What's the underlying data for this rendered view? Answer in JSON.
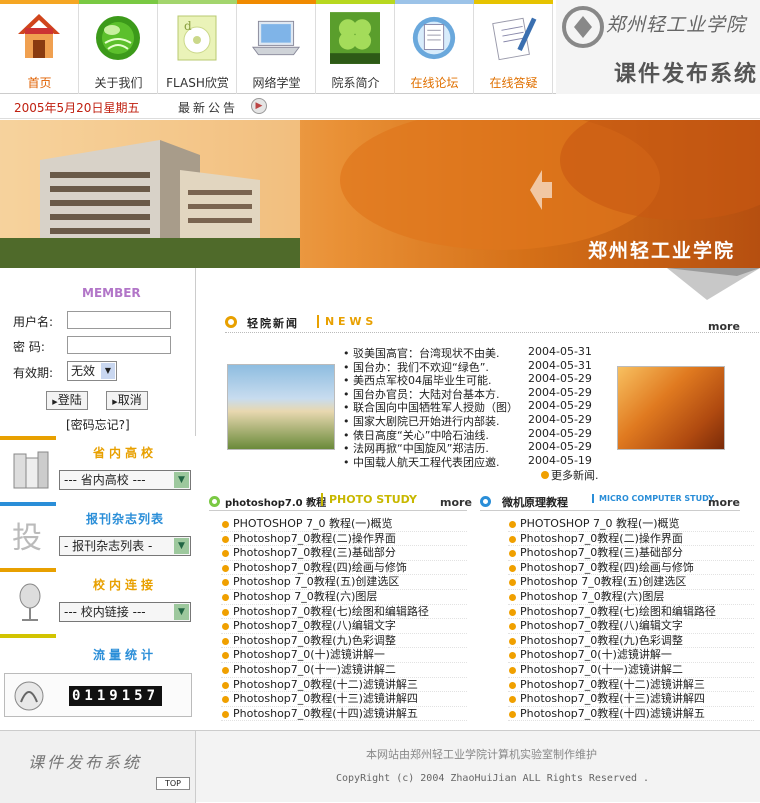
{
  "colors": {
    "accent_orange": "#f08a00",
    "date_red": "#c02010",
    "member_purple": "#b276c8",
    "news_orange": "#e8a000",
    "study_yellow": "#d2c400",
    "micro_blue": "#2a8ed8"
  },
  "nav": [
    {
      "label": "首页",
      "icon": "home-icon",
      "strip": "#f5a623",
      "color": "#e06000"
    },
    {
      "label": "关于我们",
      "icon": "globe-icon",
      "strip": "#7ac943",
      "color": "#333"
    },
    {
      "label": "FLASH欣赏",
      "icon": "flash-disc-icon",
      "strip": "#a3d56d",
      "color": "#333"
    },
    {
      "label": "网络学堂",
      "icon": "laptop-icon",
      "strip": "#f08a00",
      "color": "#333"
    },
    {
      "label": "院系简介",
      "icon": "clover-server-icon",
      "strip": "#b8d820",
      "color": "#333"
    },
    {
      "label": "在线论坛",
      "icon": "forum-icon",
      "strip": "#9cc3e8",
      "color": "#e07000"
    },
    {
      "label": "在线答疑",
      "icon": "notepad-icon",
      "strip": "#e6c300",
      "color": "#e07000"
    }
  ],
  "logo": {
    "school": "郑州轻工业学院",
    "system": "课件发布系统"
  },
  "datebar": {
    "date": "2005年5月20日星期五",
    "announce": "最新公告"
  },
  "banner": {
    "school_name": "郑州轻工业学院"
  },
  "member": {
    "title": "MEMBER",
    "username_label": "用户名:",
    "password_label": "密  码:",
    "validity_label": "有效期:",
    "validity_value": "无效",
    "login": "登陆",
    "cancel": "取消",
    "forgot": "[密码忘记?]"
  },
  "blocks": [
    {
      "title": "省内高校",
      "select": "--- 省内高校 ---",
      "color": "#e8a000",
      "icon": "books-icon"
    },
    {
      "title": "报刊杂志列表",
      "select": "- 报刊杂志列表 -",
      "color": "#2a8ed8",
      "icon": "publish-icon"
    },
    {
      "title": "校内连接",
      "select": "--- 校内链接 ---",
      "color": "#e8a000",
      "icon": "microphone-icon"
    }
  ],
  "stats": {
    "title": "流量统计",
    "counter": "0119157"
  },
  "news": {
    "title_cn": "轻院新闻",
    "title_en": "N E W S",
    "more": "more",
    "more_news": "更多新闻.",
    "items": [
      {
        "t": "驳美国高官：台湾现状不由美.",
        "d": "2004-05-31"
      },
      {
        "t": "国台办：我们不欢迎“绿色”.",
        "d": "2004-05-31"
      },
      {
        "t": "美西点军校04届毕业生可能.",
        "d": "2004-05-29"
      },
      {
        "t": "国台办官员：大陆对台基本方.",
        "d": "2004-05-29"
      },
      {
        "t": "联合国向中国牺牲军人授勋（图）",
        "d": "2004-05-29"
      },
      {
        "t": "国家大剧院已开始进行内部装.",
        "d": "2004-05-29"
      },
      {
        "t": "俵日高度“关心”中哈石油线.",
        "d": "2004-05-29"
      },
      {
        "t": "法网再掀“中国旋风”郑洁历.",
        "d": "2004-05-29"
      },
      {
        "t": "中国载人航天工程代表团应邀.",
        "d": "2004-05-19"
      }
    ]
  },
  "ps": {
    "title": "photoshop7.0 教程",
    "tag": "PHOTO STUDY",
    "more": "more",
    "items": [
      "PHOTOSHOP 7_0 教程(一)概览",
      "Photoshop7_0教程(二)操作界面",
      "Photoshop7_0教程(三)基础部分",
      "Photoshop7_0教程(四)绘画与修饰",
      "Photoshop 7_0教程(五)创建选区",
      "Photoshop 7_0教程(六)图层",
      "Photoshop7_0教程(七)绘图和编辑路径",
      "Photoshop7_0教程(八)编辑文字",
      "Photoshop7_0教程(九)色彩调整",
      "Photoshop7_0(十)滤镜讲解一",
      "Photoshop7_0(十一)滤镜讲解二",
      "Photoshop7_0教程(十二)滤镜讲解三",
      "Photoshop7_0教程(十三)滤镜讲解四",
      "Photoshop7_0教程(十四)滤镜讲解五"
    ]
  },
  "micro": {
    "title": "微机原理教程",
    "tag": "MICRO COMPUTER STUDY",
    "more": "more",
    "items": [
      "PHOTOSHOP 7_0 教程(一)概览",
      "Photoshop7_0教程(二)操作界面",
      "Photoshop7_0教程(三)基础部分",
      "Photoshop7_0教程(四)绘画与修饰",
      "Photoshop 7_0教程(五)创建选区",
      "Photoshop 7_0教程(六)图层",
      "Photoshop7_0教程(七)绘图和编辑路径",
      "Photoshop7_0教程(八)编辑文字",
      "Photoshop7_0教程(九)色彩调整",
      "Photoshop7_0(十)滤镜讲解一",
      "Photoshop7_0(十一)滤镜讲解二",
      "Photoshop7_0教程(十二)滤镜讲解三",
      "Photoshop7_0教程(十三)滤镜讲解四",
      "Photoshop7_0教程(十四)滤镜讲解五"
    ]
  },
  "footer": {
    "logo": "课件发布系统",
    "top": "TOP",
    "line1": "本网站由郑州轻工业学院计算机实验室制作维护",
    "line2": "CopyRight (c) 2004  ZhaoHuiJian   ALL Rights Reserved ."
  }
}
